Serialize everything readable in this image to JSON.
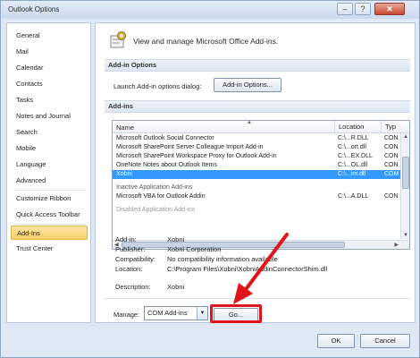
{
  "window": {
    "title": "Outlook Options",
    "minimize": "–",
    "maximize": "?",
    "close": "✕"
  },
  "nav": {
    "items": [
      {
        "label": "General"
      },
      {
        "label": "Mail"
      },
      {
        "label": "Calendar"
      },
      {
        "label": "Contacts"
      },
      {
        "label": "Tasks"
      },
      {
        "label": "Notes and Journal"
      },
      {
        "label": "Search"
      },
      {
        "label": "Mobile"
      },
      {
        "label": "Language"
      },
      {
        "label": "Advanced"
      },
      {
        "label": "Customize Ribbon"
      },
      {
        "label": "Quick Access Toolbar"
      },
      {
        "label": "Add-Ins"
      },
      {
        "label": "Trust Center"
      }
    ],
    "active": "Add-Ins"
  },
  "main": {
    "header_text": "View and manage Microsoft Office Add-ins.",
    "addin_options_title": "Add-in Options",
    "launch_label": "Launch Add-in options dialog:",
    "addin_options_button": "Add-in Options...",
    "addins_title": "Add-ins",
    "columns": {
      "name": "Name",
      "location": "Location",
      "type": "Typ"
    },
    "rows": [
      {
        "name": "Microsoft Outlook Social Connector",
        "location": "C:\\...R.DLL",
        "type": "CON"
      },
      {
        "name": "Microsoft SharePoint Server Colleague Import Add-in",
        "location": "C:\\...ort.dll",
        "type": "CON"
      },
      {
        "name": "Microsoft SharePoint Workspace Proxy for Outlook Add-in",
        "location": "C:\\...EX.DLL",
        "type": "CON"
      },
      {
        "name": "OneNote Notes about Outlook Items",
        "location": "C:\\...OL.dll",
        "type": "CON"
      },
      {
        "name": "Xobni",
        "location": "C:\\...im.dll",
        "type": "COM"
      }
    ],
    "inactive_group": "Inactive Application Add-ins",
    "inactive_rows": [
      {
        "name": "Microsoft VBA for Outlook Addin",
        "location": "C:\\...A.DLL",
        "type": "CON"
      }
    ],
    "disabled_group": "Disabled Application Add-ins",
    "details": {
      "addin_label": "Add-in:",
      "addin": "Xobni",
      "publisher_label": "Publisher:",
      "publisher": "Xobni Corporation",
      "compat_label": "Compatibility:",
      "compat": "No compatibility information available",
      "location_label": "Location:",
      "location": "C:\\Program Files\\Xobni\\XobniAddinConnectorShim.dll",
      "description_label": "Description:",
      "description": "Xobni"
    },
    "manage_label": "Manage:",
    "manage_value": "COM Add-ins",
    "go_button": "Go..."
  },
  "footer": {
    "ok": "OK",
    "cancel": "Cancel"
  },
  "colors": {
    "highlight": "#e0141b",
    "selected_row": "#3399ff",
    "active_nav": "#f9cf6a"
  }
}
